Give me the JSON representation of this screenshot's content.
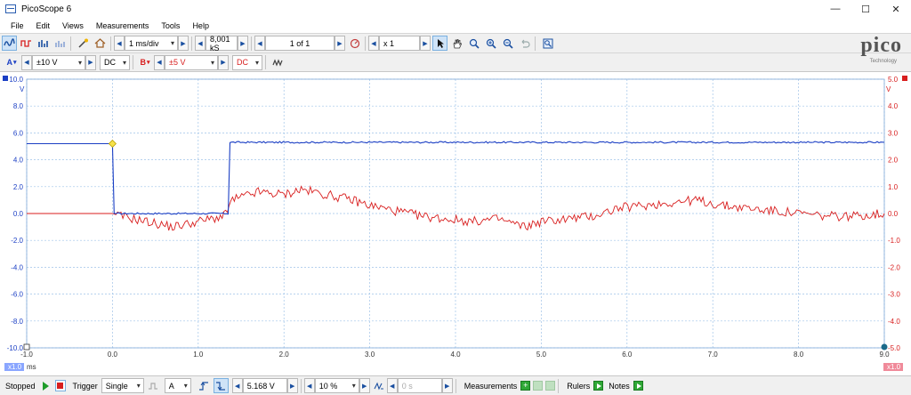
{
  "window": {
    "title": "PicoScope 6",
    "minimize_icon": "minimize-icon",
    "maximize_icon": "maximize-icon",
    "close_icon": "close-icon",
    "min_glyph": "—",
    "max_glyph": "☐",
    "close_glyph": "✕"
  },
  "menu": [
    "File",
    "Edit",
    "Views",
    "Measurements",
    "Tools",
    "Help"
  ],
  "toolbar": {
    "timebase": "1 ms/div",
    "samples": "8,001 kS",
    "buffer": "1 of 1",
    "zoom": "x 1"
  },
  "channels": {
    "a": {
      "label": "A",
      "range": "±10 V",
      "coupling": "DC",
      "color": "#1b3fc4"
    },
    "b": {
      "label": "B",
      "range": "±5 V",
      "coupling": "DC",
      "color": "#d81e1e"
    }
  },
  "logo": {
    "word": "pico",
    "sub": "Technology"
  },
  "scope": {
    "left_unit": "V",
    "right_unit": "V",
    "left_ticks": [
      "10.0",
      "8.0",
      "6.0",
      "4.0",
      "2.0",
      "0.0",
      "-2.0",
      "-4.0",
      "-6.0",
      "-8.0",
      "-10.0"
    ],
    "right_ticks": [
      "5.0",
      "4.0",
      "3.0",
      "2.0",
      "1.0",
      "0.0",
      "-1.0",
      "-2.0",
      "-3.0",
      "-4.0",
      "-5.0"
    ],
    "x_ticks": [
      "-1.0",
      "0.0",
      "1.0",
      "2.0",
      "3.0",
      "4.0",
      "5.0",
      "6.0",
      "7.0",
      "8.0",
      "9.0"
    ],
    "x_unit": "ms",
    "x_zoom_left": "x1.0",
    "x_zoom_right": "x1.0"
  },
  "chart_data": {
    "type": "line",
    "x_unit": "ms",
    "xlim": [
      -1.0,
      9.0
    ],
    "grid": true,
    "series": [
      {
        "channel": "A",
        "color": "#1b3fc4",
        "ylim": [
          -10,
          10
        ],
        "points": [
          [
            -1.0,
            5.2
          ],
          [
            0.0,
            5.2
          ],
          [
            0.02,
            0.0
          ],
          [
            1.35,
            0.0
          ],
          [
            1.37,
            5.3
          ],
          [
            9.0,
            5.3
          ]
        ]
      },
      {
        "channel": "B",
        "color": "#d81e1e",
        "ylim": [
          -5,
          5
        ],
        "points": [
          [
            -1.0,
            0.0
          ],
          [
            0.0,
            0.0
          ],
          [
            0.1,
            -0.1
          ],
          [
            0.4,
            -0.3
          ],
          [
            0.7,
            -0.5
          ],
          [
            1.0,
            -0.3
          ],
          [
            1.3,
            -0.1
          ],
          [
            1.4,
            0.5
          ],
          [
            1.7,
            0.8
          ],
          [
            2.0,
            0.7
          ],
          [
            2.2,
            0.9
          ],
          [
            2.5,
            0.7
          ],
          [
            2.8,
            0.5
          ],
          [
            3.0,
            0.3
          ],
          [
            3.3,
            0.1
          ],
          [
            3.6,
            -0.1
          ],
          [
            3.9,
            -0.2
          ],
          [
            4.2,
            -0.3
          ],
          [
            4.5,
            -0.2
          ],
          [
            4.8,
            -0.5
          ],
          [
            5.0,
            -0.3
          ],
          [
            5.3,
            -0.2
          ],
          [
            5.6,
            -0.1
          ],
          [
            5.9,
            0.2
          ],
          [
            6.2,
            0.3
          ],
          [
            6.5,
            0.4
          ],
          [
            6.8,
            0.5
          ],
          [
            7.1,
            0.3
          ],
          [
            7.4,
            0.2
          ],
          [
            7.7,
            0.1
          ],
          [
            8.0,
            0.0
          ],
          [
            8.3,
            -0.1
          ],
          [
            8.6,
            -0.1
          ],
          [
            9.0,
            0.0
          ]
        ]
      }
    ]
  },
  "trigger_marker": {
    "time_ms": 0.0,
    "level_v": 5.2
  },
  "status": {
    "state": "Stopped",
    "trigger_label": "Trigger",
    "trigger_mode": "Single",
    "trigger_source": "A",
    "trigger_level": "5.168 V",
    "pretrigger": "10 %",
    "delay": "0 s",
    "measurements_label": "Measurements",
    "rulers_label": "Rulers",
    "notes_label": "Notes"
  }
}
